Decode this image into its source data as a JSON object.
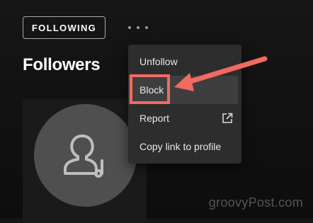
{
  "header": {
    "following_label": "FOLLOWING",
    "more_icon": "more-horizontal-icon"
  },
  "section": {
    "title": "Followers"
  },
  "profile_card": {
    "avatar_icon": "user-music-icon"
  },
  "context_menu": {
    "items": [
      {
        "label": "Unfollow"
      },
      {
        "label": "Block",
        "highlighted": true
      },
      {
        "label": "Report",
        "icon": "external-link-icon"
      },
      {
        "label": "Copy link to profile"
      }
    ]
  },
  "annotation": {
    "color": "#f26a61"
  },
  "watermark": "groovyPost.com"
}
